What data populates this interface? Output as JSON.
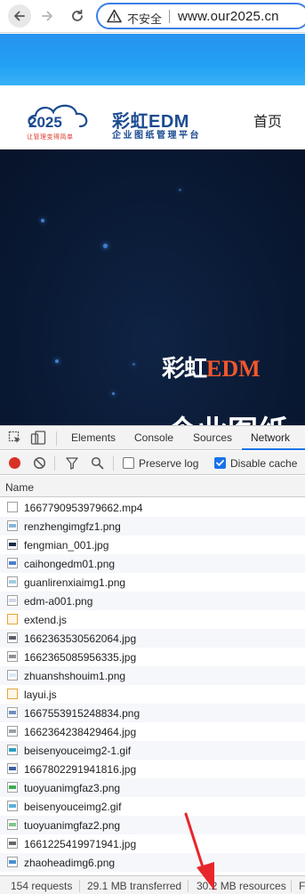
{
  "browser": {
    "security_label": "不安全",
    "url": "www.our2025.cn"
  },
  "site": {
    "logo_number": "2025",
    "logo_slogan": "让管理变得简单",
    "brand_name": "彩虹EDM",
    "brand_sub": "企业图纸管理平台",
    "nav_home": "首页",
    "hero_title_cn": "彩虹",
    "hero_title_en": "EDM",
    "hero_sub": "企业图纸"
  },
  "devtools": {
    "tabs": [
      "Elements",
      "Console",
      "Sources",
      "Network"
    ],
    "active_tab": "Network",
    "preserve_log_label": "Preserve log",
    "preserve_log_checked": false,
    "disable_cache_label": "Disable cache",
    "disable_cache_checked": true,
    "column_name": "Name",
    "requests": [
      {
        "name": "1667790953979662.mp4",
        "icon": "media-file-icon"
      },
      {
        "name": "renzhengimgfz1.png",
        "icon": "image-file-icon"
      },
      {
        "name": "fengmian_001.jpg",
        "icon": "image-file-icon"
      },
      {
        "name": "caihongedm01.png",
        "icon": "image-file-icon"
      },
      {
        "name": "guanlirenxiaimg1.png",
        "icon": "image-file-icon"
      },
      {
        "name": "edm-a001.png",
        "icon": "image-file-icon"
      },
      {
        "name": "extend.js",
        "icon": "script-file-icon"
      },
      {
        "name": "1662363530562064.jpg",
        "icon": "image-file-icon"
      },
      {
        "name": "1662365085956335.jpg",
        "icon": "image-file-icon"
      },
      {
        "name": "zhuanshshouim1.png",
        "icon": "image-file-icon"
      },
      {
        "name": "layui.js",
        "icon": "script-file-icon"
      },
      {
        "name": "1667553915248834.png",
        "icon": "image-file-icon"
      },
      {
        "name": "1662364238429464.jpg",
        "icon": "image-file-icon"
      },
      {
        "name": "beisenyouceimg2-1.gif",
        "icon": "image-file-icon"
      },
      {
        "name": "1667802291941816.jpg",
        "icon": "image-file-icon"
      },
      {
        "name": "tuoyuanimgfaz3.png",
        "icon": "image-file-icon"
      },
      {
        "name": "beisenyouceimg2.gif",
        "icon": "image-file-icon"
      },
      {
        "name": "tuoyuanimgfaz2.png",
        "icon": "image-file-icon"
      },
      {
        "name": "1661225419971941.jpg",
        "icon": "image-file-icon"
      },
      {
        "name": "zhaoheadimg6.png",
        "icon": "image-file-icon"
      }
    ],
    "status": {
      "requests": "154 requests",
      "transferred": "29.1 MB transferred",
      "resources": "30.2 MB resources",
      "finish": "F"
    }
  },
  "colors": {
    "accent": "#1a73e8",
    "record": "#d93025",
    "annotation_arrow": "#e8262b",
    "brand_blue": "#1b4b91",
    "brand_orange": "#f0572c"
  }
}
